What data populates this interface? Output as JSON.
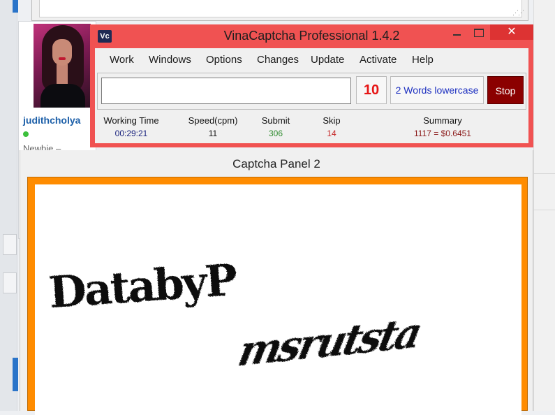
{
  "forum": {
    "username": "judithcholya",
    "rank": "Newbie  –"
  },
  "app": {
    "icon_text": "Vc",
    "title": "VinaCaptcha Professional 1.4.2",
    "close_glyph": "✕",
    "menu": [
      "Work",
      "Windows",
      "Options",
      "Changes",
      "Update",
      "Activate",
      "Help"
    ],
    "captcha_input": {
      "value": "",
      "placeholder": ""
    },
    "countdown": "10",
    "mode": "2 Words lowercase",
    "stop_label": "Stop",
    "stats": [
      {
        "label": "Working Time",
        "value": "00:29:21",
        "color": "#1a237e"
      },
      {
        "label": "Speed(cpm)",
        "value": "11",
        "color": "#111111"
      },
      {
        "label": "Submit",
        "value": "306",
        "color": "#2e8b2e"
      },
      {
        "label": "Skip",
        "value": "14",
        "color": "#c62828"
      },
      {
        "label": "Summary",
        "value": "1117 = $0.6451",
        "color": "#8b1a1a"
      }
    ],
    "colors": {
      "titlebar": "#f05252",
      "accent_orange": "#ff8c00",
      "stop": "#8b0000"
    }
  },
  "panel": {
    "title": "Captcha Panel 2",
    "captcha_words": [
      "DatabyP",
      "msrutsta"
    ]
  }
}
